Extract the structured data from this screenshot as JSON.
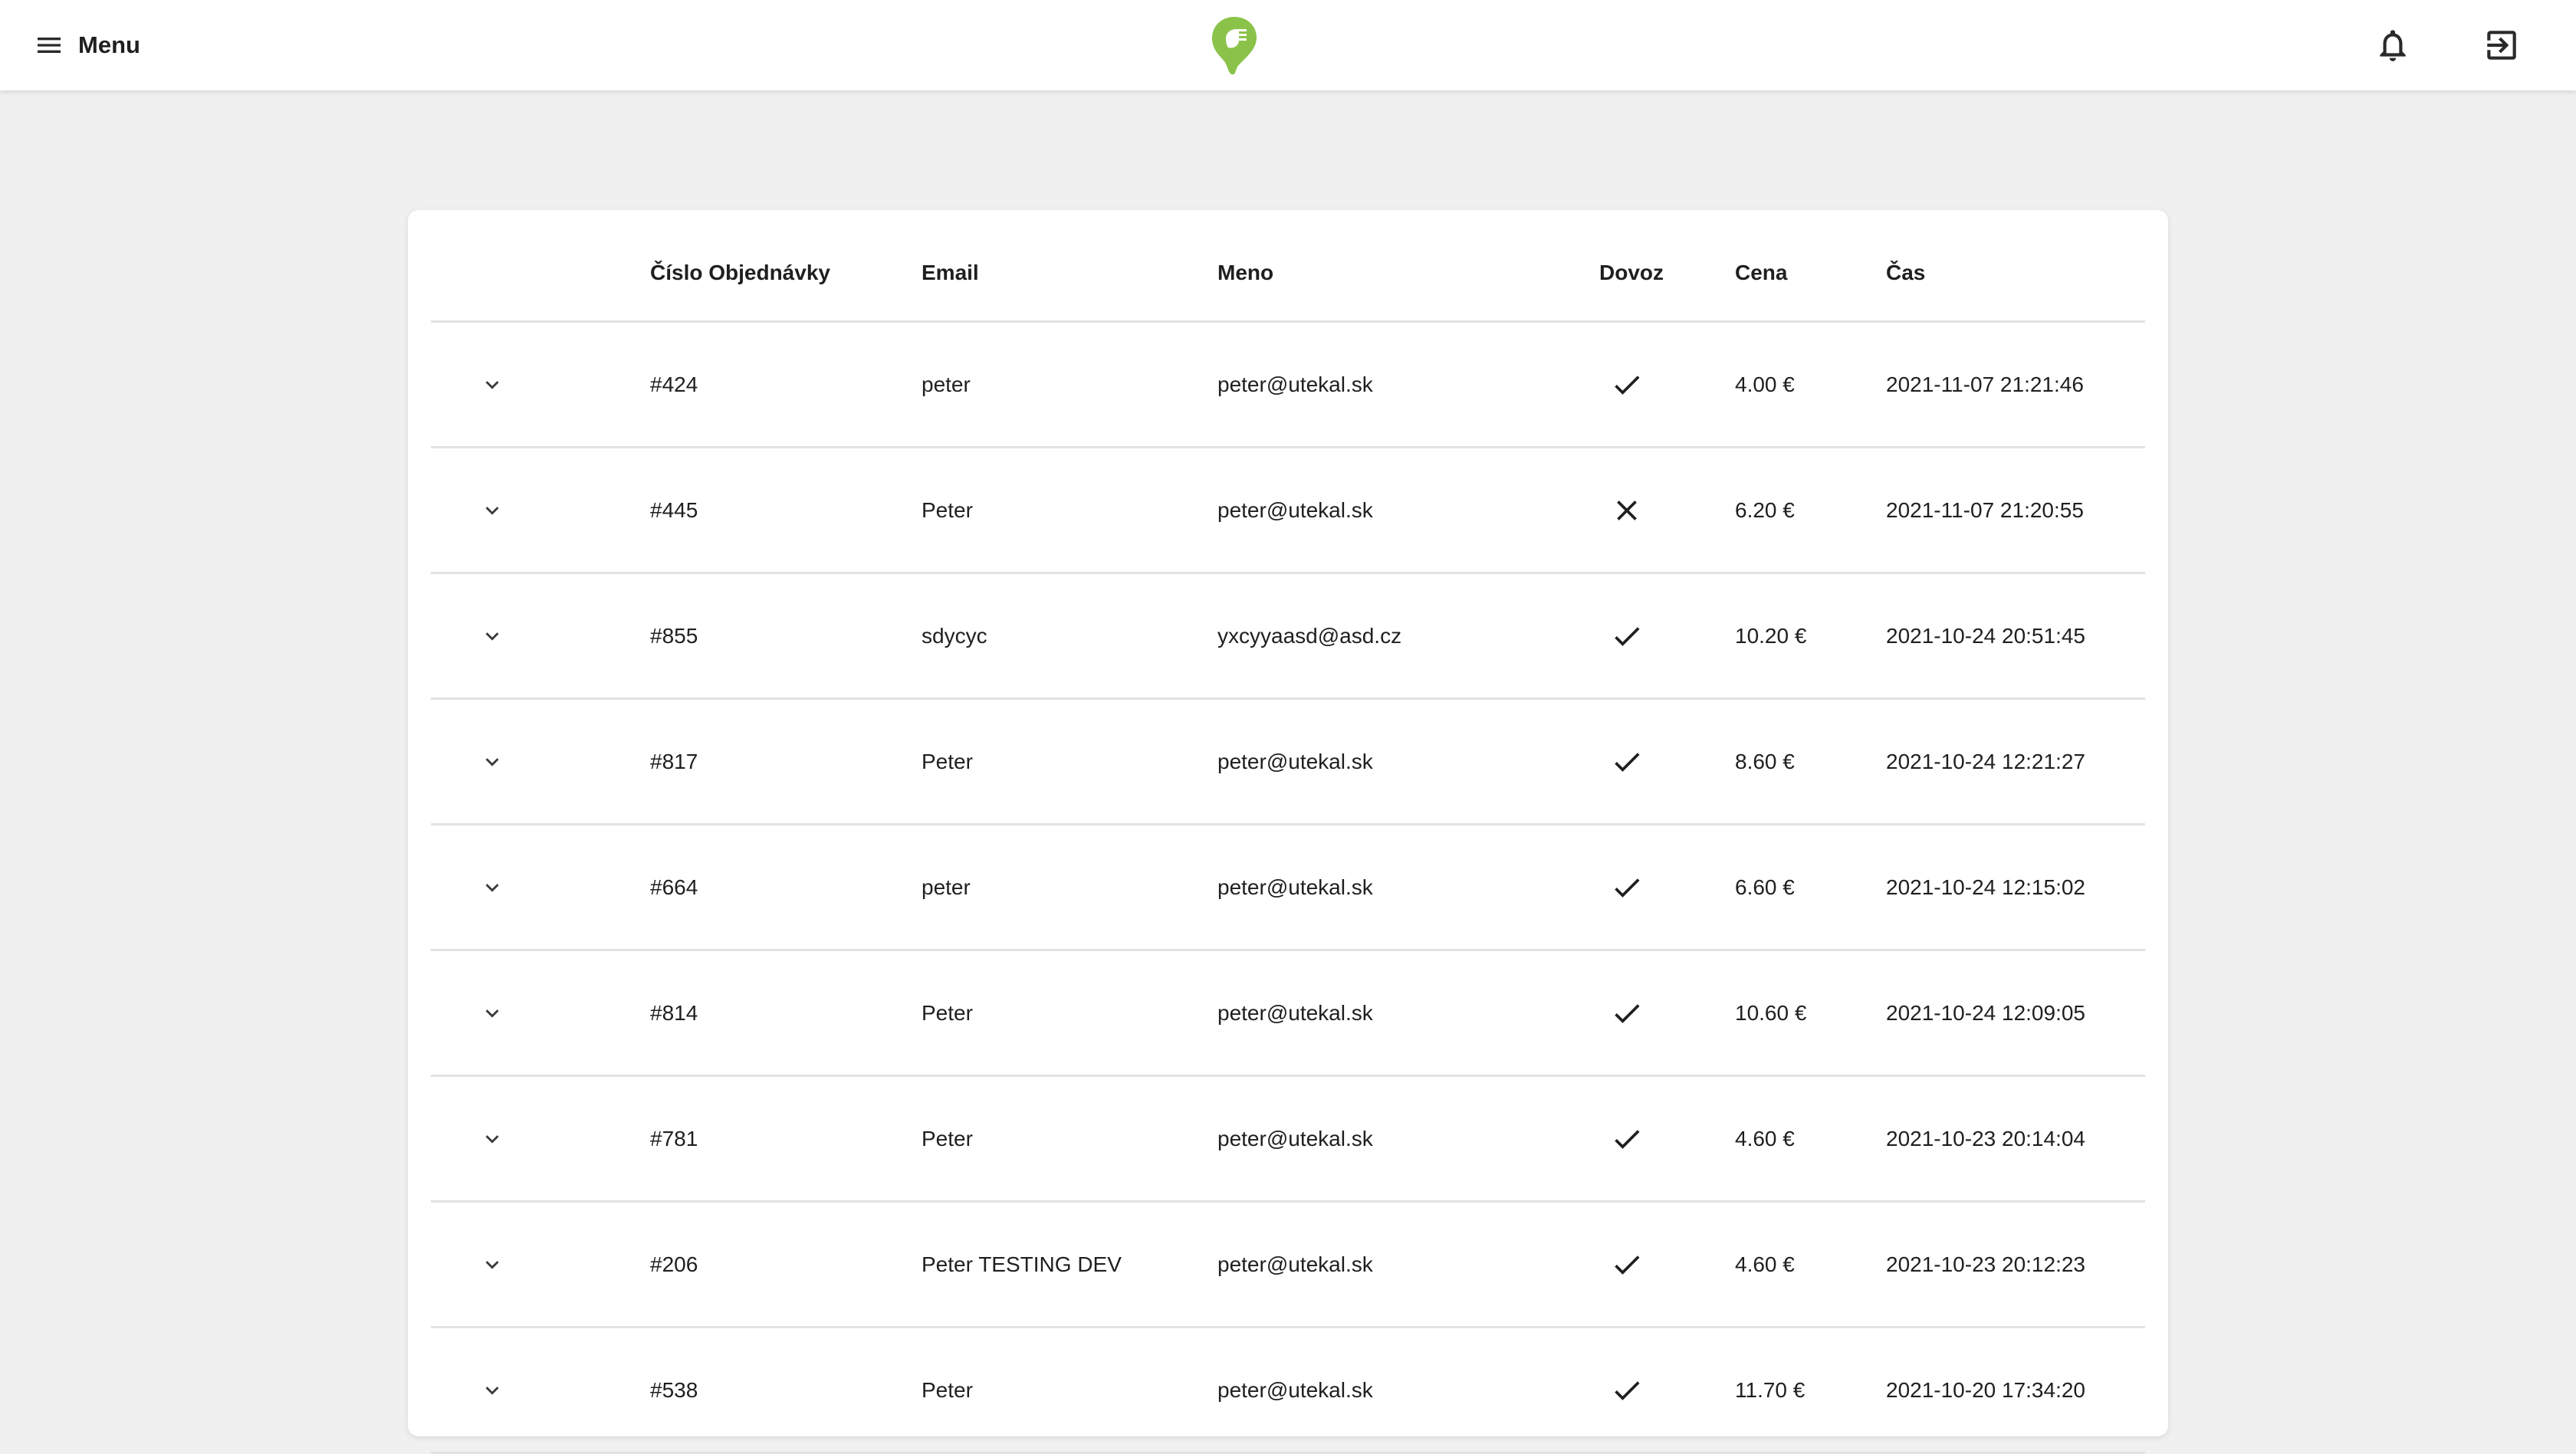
{
  "header": {
    "menu_label": "Menu",
    "menu_icon": "menu-icon",
    "logo_icon": "logo-icon",
    "notifications_icon": "bell-icon",
    "logout_icon": "logout-icon",
    "brand_color": "#8bc34a"
  },
  "table": {
    "columns": {
      "order_number": "Číslo Objednávky",
      "email": "Email",
      "name": "Meno",
      "delivery": "Dovoz",
      "price": "Cena",
      "time": "Čas"
    },
    "rows": [
      {
        "order_number": "#424",
        "email": "peter",
        "name": "peter@utekal.sk",
        "delivery": true,
        "price": "4.00 €",
        "time": "2021-11-07 21:21:46"
      },
      {
        "order_number": "#445",
        "email": "Peter",
        "name": "peter@utekal.sk",
        "delivery": false,
        "price": "6.20 €",
        "time": "2021-11-07 21:20:55"
      },
      {
        "order_number": "#855",
        "email": "sdycyc",
        "name": "yxcyyaasd@asd.cz",
        "delivery": true,
        "price": "10.20 €",
        "time": "2021-10-24 20:51:45"
      },
      {
        "order_number": "#817",
        "email": "Peter",
        "name": "peter@utekal.sk",
        "delivery": true,
        "price": "8.60 €",
        "time": "2021-10-24 12:21:27"
      },
      {
        "order_number": "#664",
        "email": "peter",
        "name": "peter@utekal.sk",
        "delivery": true,
        "price": "6.60 €",
        "time": "2021-10-24 12:15:02"
      },
      {
        "order_number": "#814",
        "email": "Peter",
        "name": "peter@utekal.sk",
        "delivery": true,
        "price": "10.60 €",
        "time": "2021-10-24 12:09:05"
      },
      {
        "order_number": "#781",
        "email": "Peter",
        "name": "peter@utekal.sk",
        "delivery": true,
        "price": "4.60 €",
        "time": "2021-10-23 20:14:04"
      },
      {
        "order_number": "#206",
        "email": "Peter TESTING DEV",
        "name": "peter@utekal.sk",
        "delivery": true,
        "price": "4.60 €",
        "time": "2021-10-23 20:12:23"
      },
      {
        "order_number": "#538",
        "email": "Peter",
        "name": "peter@utekal.sk",
        "delivery": true,
        "price": "11.70 €",
        "time": "2021-10-20 17:34:20"
      }
    ],
    "icons": {
      "expand": "chevron-down-icon",
      "delivery_yes": "check-icon",
      "delivery_no": "close-icon"
    }
  }
}
